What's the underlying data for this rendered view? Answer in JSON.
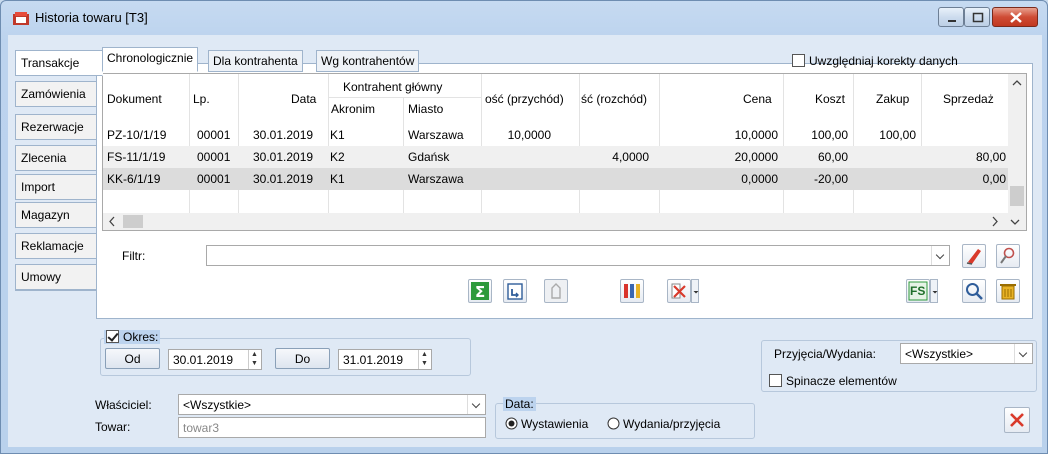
{
  "window": {
    "title": "Historia towaru [T3]"
  },
  "vtabs": [
    "Transakcje",
    "Zamówienia",
    "Rezerwacje",
    "Zlecenia",
    "Import",
    "Magazyn",
    "Reklamacje",
    "Umowy"
  ],
  "htabs": [
    "Chronologicznie",
    "Dla kontrahenta",
    "Wg kontrahentów"
  ],
  "korekty_label": "Uwzględniaj korekty danych",
  "grid": {
    "headers": {
      "dokument": "Dokument",
      "lp": "Lp.",
      "data": "Data",
      "kontrahent": "Kontrahent główny",
      "akronim": "Akronim",
      "miasto": "Miasto",
      "przychod": "ość (przychód)",
      "rozchod": "ść (rozchód)",
      "cena": "Cena",
      "koszt": "Koszt",
      "zakup": "Zakup",
      "sprzedaz": "Sprzedaż"
    },
    "rows": [
      {
        "dokument": "PZ-10/1/19",
        "lp": "00001",
        "data": "30.01.2019",
        "akronim": "K1",
        "miasto": "Warszawa",
        "przychod": "10,0000",
        "rozchod": "",
        "cena": "10,0000",
        "koszt": "100,00",
        "zakup": "100,00",
        "sprzedaz": ""
      },
      {
        "dokument": "FS-11/1/19",
        "lp": "00001",
        "data": "30.01.2019",
        "akronim": "K2",
        "miasto": "Gdańsk",
        "przychod": "",
        "rozchod": "4,0000",
        "cena": "20,0000",
        "koszt": "60,00",
        "zakup": "",
        "sprzedaz": "80,00"
      },
      {
        "dokument": "KK-6/1/19",
        "lp": "00001",
        "data": "30.01.2019",
        "akronim": "K1",
        "miasto": "Warszawa",
        "przychod": "",
        "rozchod": "",
        "cena": "0,0000",
        "koszt": "-20,00",
        "zakup": "",
        "sprzedaz": "0,00"
      }
    ]
  },
  "filter": {
    "label": "Filtr:",
    "value": ""
  },
  "okres": {
    "label": "Okres:",
    "od_label": "Od",
    "od_value": "30.01.2019",
    "do_label": "Do",
    "do_value": "31.01.2019"
  },
  "przyjecia": {
    "label": "Przyjęcia/Wydania:",
    "value": "<Wszystkie>"
  },
  "spinacze_label": "Spinacze elementów",
  "wlasciciel": {
    "label": "Właściciel:",
    "value": "<Wszystkie>"
  },
  "towar": {
    "label": "Towar:",
    "value": "towar3"
  },
  "data_group": {
    "label": "Data:",
    "opt1": "Wystawienia",
    "opt2": "Wydania/przyjęcia"
  },
  "toolbar": {
    "fs_label": "FS"
  }
}
